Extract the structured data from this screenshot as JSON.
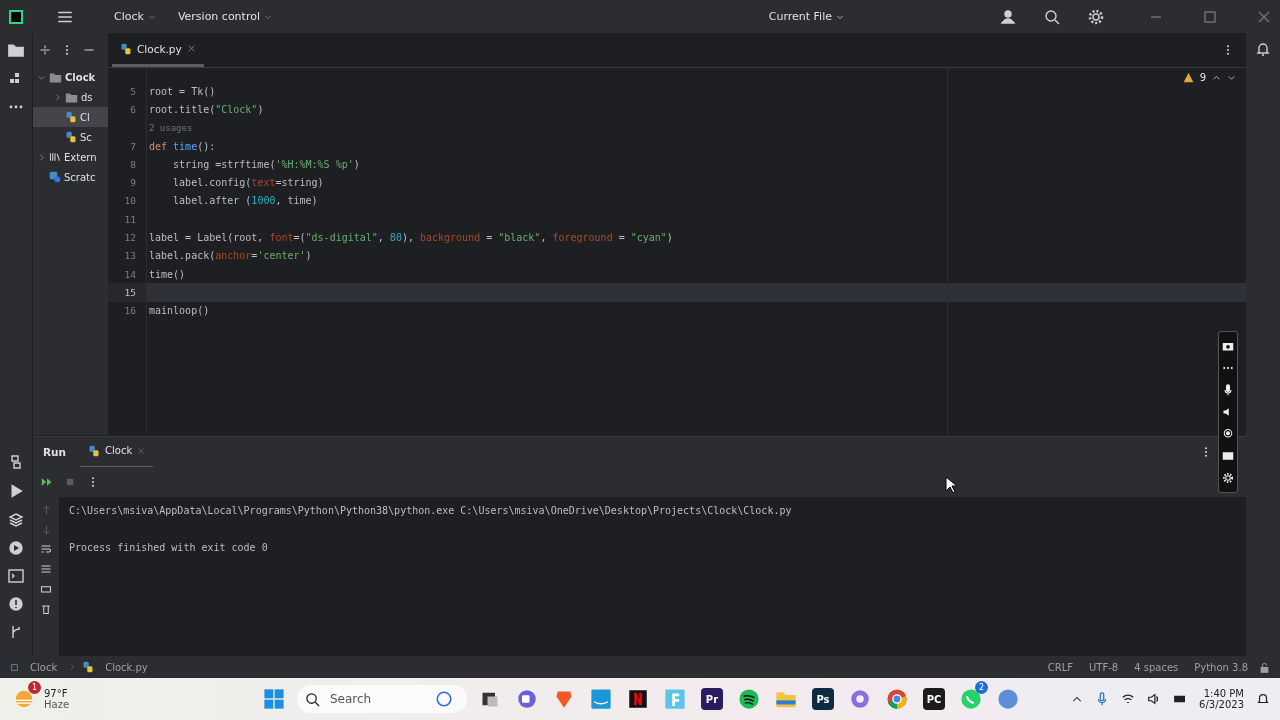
{
  "title_bar": {
    "project": "Clock",
    "vcs": "Version control",
    "run_config": "Current File"
  },
  "project_tree": [
    {
      "label": "Clock",
      "kind": "folder",
      "expanded": true,
      "selected": false,
      "children": [
        {
          "label": "ds",
          "kind": "folder",
          "expanded": false,
          "selected": false
        },
        {
          "label": "Cl",
          "kind": "python",
          "selected": true
        },
        {
          "label": "Sc",
          "kind": "python",
          "selected": false
        }
      ]
    },
    {
      "label": "Extern",
      "kind": "library",
      "expanded": false,
      "selected": false
    },
    {
      "label": "Scratc",
      "kind": "scratch",
      "selected": false
    }
  ],
  "editor": {
    "tab": {
      "label": "Clock.py",
      "selected": true
    },
    "warnings": "9",
    "lines": [
      {
        "kind": "code",
        "number": "5",
        "current": false,
        "tokens": [
          {
            "t": "root = Tk()",
            "kind": "plain"
          }
        ]
      },
      {
        "kind": "code",
        "number": "6",
        "current": false,
        "tokens": [
          {
            "t": "root.title(",
            "kind": "plain"
          },
          {
            "t": "\"Clock\"",
            "kind": "string"
          },
          {
            "t": ")",
            "kind": "plain"
          }
        ]
      },
      {
        "kind": "hint",
        "text": "2 usages"
      },
      {
        "kind": "code",
        "number": "7",
        "current": false,
        "tokens": [
          {
            "t": "def",
            "kind": "keyword"
          },
          {
            "t": " time",
            "kind": "func"
          },
          {
            "t": "():",
            "kind": "plain"
          }
        ]
      },
      {
        "kind": "code",
        "number": "8",
        "current": false,
        "tokens": [
          {
            "t": "    string =strftime(",
            "kind": "plain"
          },
          {
            "t": "'%H:%M:%S %p'",
            "kind": "string"
          },
          {
            "t": ")",
            "kind": "plain"
          }
        ]
      },
      {
        "kind": "code",
        "number": "9",
        "current": false,
        "tokens": [
          {
            "t": "    label.config(",
            "kind": "plain"
          },
          {
            "t": "text",
            "kind": "param"
          },
          {
            "t": "=string)",
            "kind": "plain"
          }
        ]
      },
      {
        "kind": "code",
        "number": "10",
        "current": false,
        "tokens": [
          {
            "t": "    label.after (",
            "kind": "plain"
          },
          {
            "t": "1000",
            "kind": "number"
          },
          {
            "t": ", time)",
            "kind": "plain"
          }
        ]
      },
      {
        "kind": "code",
        "number": "11",
        "current": false
      },
      {
        "kind": "code",
        "number": "12",
        "current": false,
        "tokens": [
          {
            "t": "label = Label(root, ",
            "kind": "plain"
          },
          {
            "t": "font",
            "kind": "param"
          },
          {
            "t": "=(",
            "kind": "plain"
          },
          {
            "t": "\"ds-digital\"",
            "kind": "string"
          },
          {
            "t": ", ",
            "kind": "plain"
          },
          {
            "t": "80",
            "kind": "number"
          },
          {
            "t": "), ",
            "kind": "plain"
          },
          {
            "t": "background",
            "kind": "param"
          },
          {
            "t": " = ",
            "kind": "plain"
          },
          {
            "t": "\"black\"",
            "kind": "string"
          },
          {
            "t": ", ",
            "kind": "plain"
          },
          {
            "t": "foreground",
            "kind": "param"
          },
          {
            "t": " = ",
            "kind": "plain"
          },
          {
            "t": "\"cyan\"",
            "kind": "string"
          },
          {
            "t": ")",
            "kind": "plain"
          }
        ]
      },
      {
        "kind": "code",
        "number": "13",
        "current": false,
        "tokens": [
          {
            "t": "label.pack(",
            "kind": "plain"
          },
          {
            "t": "anchor",
            "kind": "param"
          },
          {
            "t": "=",
            "kind": "plain"
          },
          {
            "t": "'center'",
            "kind": "string"
          },
          {
            "t": ")",
            "kind": "plain"
          }
        ]
      },
      {
        "kind": "code",
        "number": "14",
        "current": false,
        "tokens": [
          {
            "t": "time()",
            "kind": "plain"
          }
        ]
      },
      {
        "kind": "code",
        "number": "15",
        "current": true
      },
      {
        "kind": "code",
        "number": "16",
        "current": false,
        "tokens": [
          {
            "t": "mainloop()",
            "kind": "plain"
          }
        ]
      }
    ]
  },
  "run_panel": {
    "title": "Run",
    "tab": {
      "label": "Clock",
      "selected": true
    },
    "output": [
      "C:\\Users\\msiva\\AppData\\Local\\Programs\\Python\\Python38\\python.exe C:\\Users\\msiva\\OneDrive\\Desktop\\Projects\\Clock\\Clock.py",
      "Process finished with exit code 0"
    ]
  },
  "status_bar": {
    "breadcrumbs": [
      "Clock",
      "Clock.py"
    ],
    "items": [
      "CRLF",
      "UTF-8",
      "4 spaces",
      "Python 3.8"
    ]
  },
  "taskbar": {
    "weather": {
      "temp": "97°F",
      "condition": "Haze",
      "badge": "1"
    },
    "search": {
      "placeholder": "Search"
    },
    "apps": [
      {
        "kind": "files"
      },
      {
        "kind": "meet"
      },
      {
        "kind": "brave"
      },
      {
        "kind": "prime"
      },
      {
        "kind": "netflix"
      },
      {
        "kind": "app-f"
      },
      {
        "kind": "tile",
        "label": "Pr",
        "color": "#2a1a5e"
      },
      {
        "kind": "spotify"
      },
      {
        "kind": "explorer"
      },
      {
        "kind": "tile",
        "label": "Ps",
        "color": "#0e2a44"
      },
      {
        "kind": "copilot"
      },
      {
        "kind": "chrome"
      },
      {
        "kind": "tile",
        "label": "PC",
        "color": "#1c1c1c"
      },
      {
        "kind": "whatsapp",
        "badge": "2"
      },
      {
        "kind": "qb"
      }
    ],
    "time": "1:40 PM",
    "date": "6/3/2023"
  }
}
